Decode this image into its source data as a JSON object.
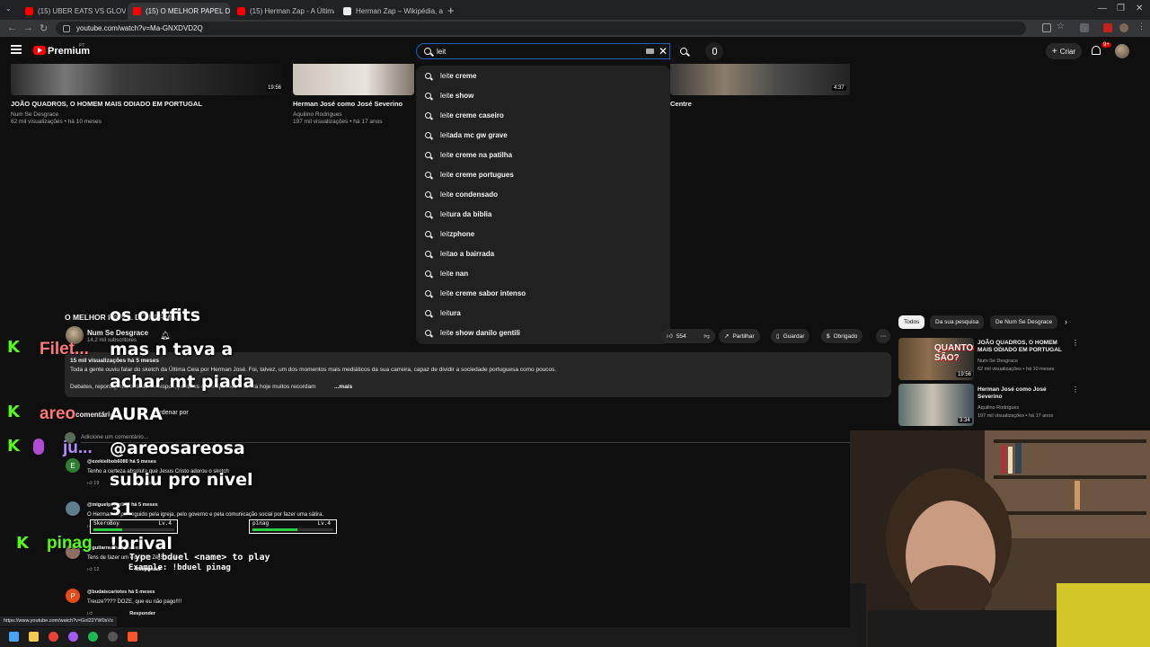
{
  "browser": {
    "tabs": [
      {
        "label": "(15) UBER EATS VS GLOVO I CU"
      },
      {
        "label": "(15) O MELHOR PAPEL DO HER"
      },
      {
        "label": "(15) Herman Zap - A Última Ce"
      },
      {
        "label": "Herman Zap – Wikipédia, a enc"
      }
    ],
    "url": "youtube.com/watch?v=Ma-GNXDVD2Q",
    "status_url": "https://www.youtube.com/watch?v=Gnl22YW0sVs"
  },
  "header": {
    "brand": "Premium",
    "brand_sup": "PT",
    "search_value": "leit",
    "create_label": "Criar",
    "notifications": "9+"
  },
  "top_videos": [
    {
      "title": "JOÃO QUADROS, O HOMEM MAIS ODIADO EM PORTUGAL",
      "channel": "Num Se Desgrace",
      "meta": "62 mil visualizações • há 10 meses",
      "duration": "19:56"
    },
    {
      "title": "Herman José como José Severino",
      "channel": "Aquilino Rodrigues",
      "meta": "197 mil visualizações • há 17 anos"
    },
    {
      "title": "Centre",
      "duration": "4:37"
    }
  ],
  "suggestions": [
    {
      "prefix": "leit",
      "rest": "e creme"
    },
    {
      "prefix": "leit",
      "rest": "e show"
    },
    {
      "prefix": "leit",
      "rest": "e creme caseiro"
    },
    {
      "prefix": "leit",
      "rest": "ada mc gw grave"
    },
    {
      "prefix": "leit",
      "rest": "e creme na patilha"
    },
    {
      "prefix": "leit",
      "rest": "e creme portugues"
    },
    {
      "prefix": "leit",
      "rest": "e condensado"
    },
    {
      "prefix": "leit",
      "rest": "ura da biblia"
    },
    {
      "prefix": "leit",
      "rest": "zphone"
    },
    {
      "prefix": "leit",
      "rest": "ao a bairrada"
    },
    {
      "prefix": "leit",
      "rest": "e nan"
    },
    {
      "prefix": "leit",
      "rest": "e creme sabor intenso"
    },
    {
      "prefix": "leit",
      "rest": "ura"
    },
    {
      "prefix": "leit",
      "rest": "e show danilo gentili"
    }
  ],
  "video": {
    "title": "O MELHOR PAPEL DO HERMAN",
    "channel": "Num Se Desgrace",
    "subscribers": "14,2 mil subscritores",
    "likes": "554",
    "share": "Partilhar",
    "save": "Guardar",
    "thanks": "Obrigado",
    "stats": "15 mil visualizações  há 5 meses",
    "desc_line1": "Toda a gente ouviu falar do sketch da Última Ceia por Herman José. Foi, talvez, um dos momentos mais mediáticos da sua carreira, capaz de dividir a sociedade portuguesa como poucos.",
    "desc_line2": "Debates, reportagens, críticas de bispos, políticos e até opiniões... ainda hoje muitos recordam",
    "desc_more": "...mais"
  },
  "comments": {
    "count": "comentários",
    "sort": "Ordenar por",
    "add_placeholder": "Adicione um comentário...",
    "items": [
      {
        "initial": "E",
        "author": "@ezekielbob6080  há 5 meses",
        "text": "Tenho a certeza absoluta que Jesus Cristo adorou o sketch",
        "likes": "19",
        "reply": "Responder",
        "color": "#2e7d32"
      },
      {
        "initial": "",
        "author": "@miguelpedro960  há 5 meses",
        "text": "O Herman foi perseguido pela igreja, pelo governo e pela comunicação social por fazer uma sátira.",
        "likes": "",
        "reply": "",
        "color": "#607d8b"
      },
      {
        "initial": "",
        "author": "@guitarras  há 5 meses",
        "text": "Tens de fazer um vídeo do Zé Severino",
        "likes": "12",
        "reply": "Responder",
        "color": "#8d6e63"
      },
      {
        "initial": "P",
        "author": "@budaiscariotes  há 5 meses",
        "text": "Treuze???? DOZE, que eu não pago!!!!",
        "likes": "",
        "reply": "Responder",
        "color": "#e64a19"
      }
    ]
  },
  "sidebar": {
    "chips": [
      "Todos",
      "Da sua pesquisa",
      "De Num Se Desgrace"
    ],
    "videos": [
      {
        "title": "JOÃO QUADROS, O HOMEM MAIS ODIADO EM PORTUGAL",
        "channel": "Num Se Desgrace",
        "meta": "62 mil visualizações • há 10 meses",
        "duration": "19:56",
        "overlay": "QUANTOS SÃO?"
      },
      {
        "title": "Herman José como José Severino",
        "channel": "Aquilino Rodrigues",
        "meta": "197 mil visualizações • há 17 anos",
        "duration": "3:34"
      }
    ]
  },
  "overlay": {
    "chat": [
      {
        "name": "",
        "msg": "os outfits"
      },
      {
        "name": "Filet...",
        "msg": "mas n tava a"
      },
      {
        "name": "",
        "msg": "achar mt piada"
      },
      {
        "name": "areo",
        "msg": "AURA"
      },
      {
        "name": "ju...",
        "msg": "@areosareosa"
      },
      {
        "name": "",
        "msg": "subiu pro nivel"
      },
      {
        "name": "",
        "msg": "31"
      },
      {
        "name": "pinag",
        "msg": "!brival"
      }
    ],
    "duel_cards": [
      {
        "name": "SkeroBoy",
        "level": "Lv.4",
        "hp": 0.35
      },
      {
        "name": "pinag",
        "level": "Lv.4",
        "hp": 0.55
      }
    ],
    "duel_help": "Type !bduel <name> to play",
    "duel_example": "Example: !bduel pinag"
  },
  "colors": {
    "accent": "#1c62b9",
    "youtube_red": "#ff0000",
    "kick_green": "#53fc18"
  }
}
